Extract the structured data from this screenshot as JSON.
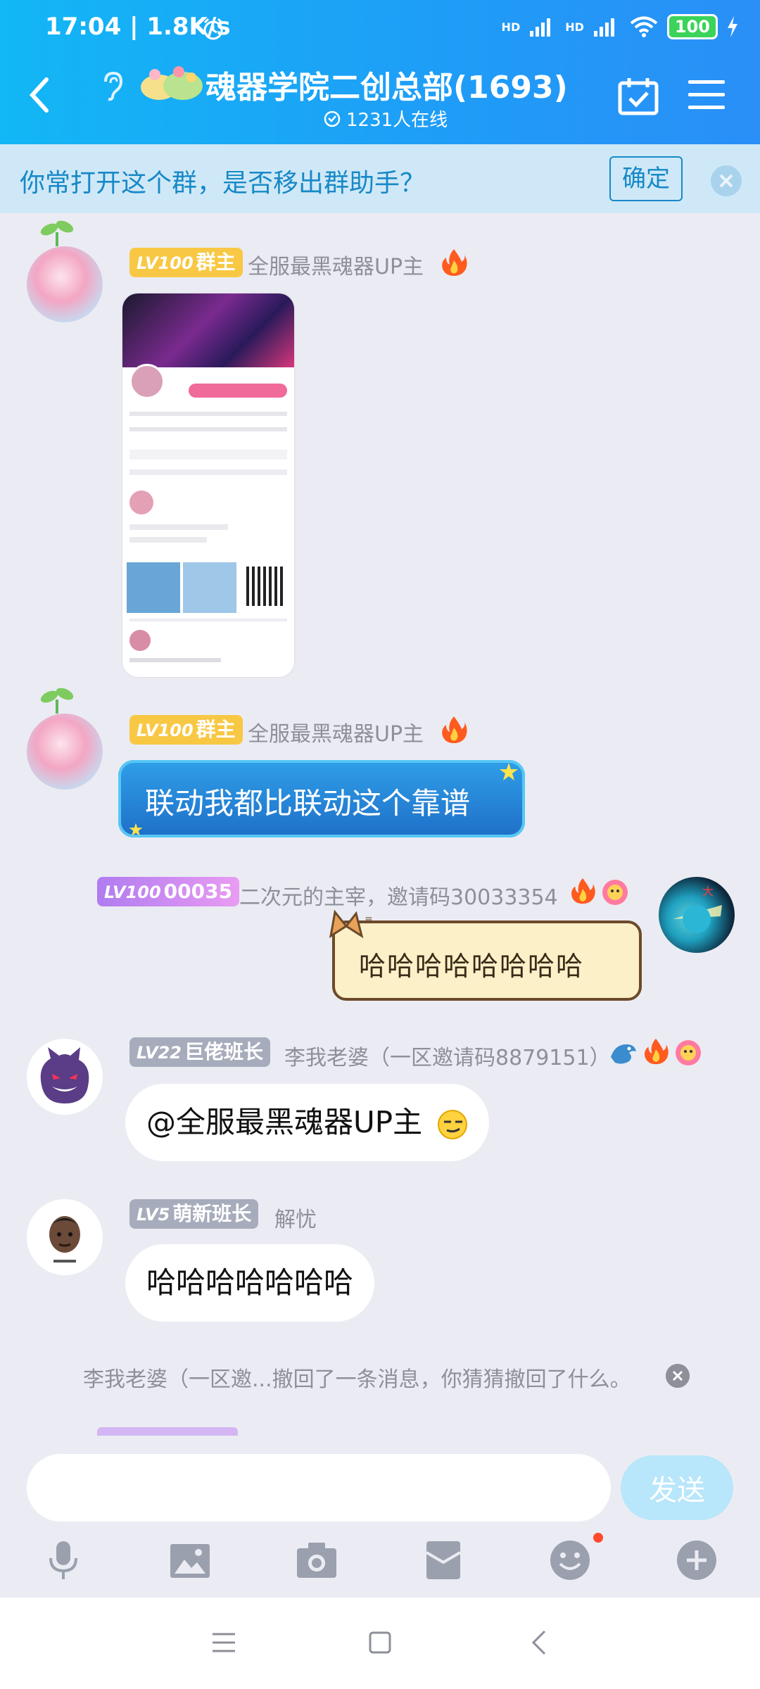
{
  "status": {
    "time": "17:04 | 1.8K/s",
    "battery": "100",
    "hd1": "HD",
    "hd2": "HD"
  },
  "header": {
    "title": "魂器学院二创总部(1693)",
    "online": "1231人在线"
  },
  "notice": {
    "text": "你常打开这个群，是否移出群助手？",
    "confirm": "确定"
  },
  "messages": [
    {
      "level": "LV100",
      "role": "群主",
      "nick": "全服最黑魂器UP主"
    },
    {
      "level": "LV100",
      "role": "群主",
      "nick": "全服最黑魂器UP主",
      "text": "联动我都比联动这个靠谱"
    },
    {
      "level": "LV100",
      "role": "00035",
      "nick": "二次元的主宰，邀请码30033354",
      "text": "哈哈哈哈哈哈哈哈"
    },
    {
      "level": "LV22",
      "role": "巨佬班长",
      "nick": "李我老婆（一区邀请码8879151）",
      "text": "@全服最黑魂器UP主"
    },
    {
      "level": "LV5",
      "role": "萌新班长",
      "nick": "解忧",
      "text": "哈哈哈哈哈哈哈"
    }
  ],
  "recall": "李我老婆（一区邀...撤回了一条消息，你猜猜撤回了什么。",
  "input": {
    "placeholder": "",
    "send": "发送"
  },
  "colors": {
    "header": "#12b7f5",
    "owner_badge": "#f8c844",
    "purple_badge": "#c18cf5",
    "gray_badge": "#a7acbc"
  }
}
